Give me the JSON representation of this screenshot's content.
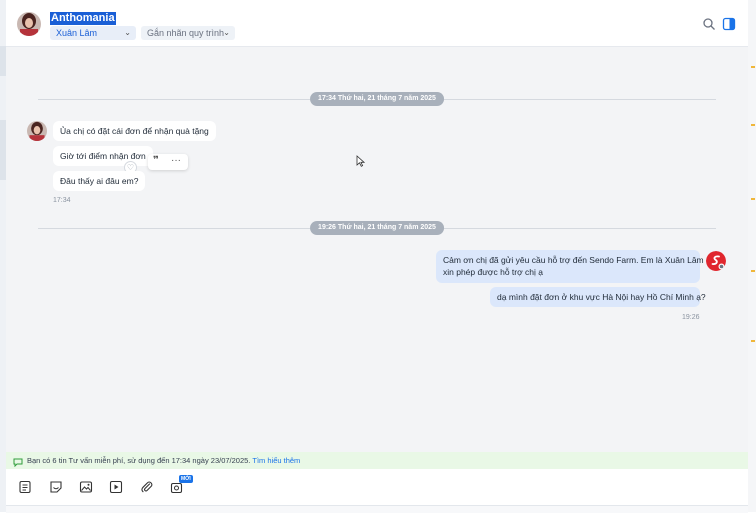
{
  "header": {
    "contact_name": "Anthomania",
    "agent_selector": "Xuân Lâm",
    "process_selector": "Gắn nhãn quy trình",
    "icons": [
      "search-icon",
      "side-panel-icon"
    ]
  },
  "chat": {
    "separators": [
      "17:34 Thứ hai, 21 tháng 7 năm 2025",
      "19:26 Thứ hai, 21 tháng 7 năm 2025"
    ],
    "incoming": [
      "Ủa chị có đặt cái đơn để nhận quà tặng",
      "Giờ tới điểm nhận đơn",
      "Đâu thấy ai đâu em?"
    ],
    "incoming_time": "17:34",
    "outgoing": [
      "Cảm ơn chị đã gửi yêu cầu hỗ trợ đến Sendo Farm. Em là Xuân Lâm",
      "xin phép được hỗ trợ chị ạ",
      "dạ mình đặt đơn ở khu vực Hà Nội hay Hồ Chí Minh ạ?"
    ],
    "outgoing_time": "19:26",
    "hover_actions": [
      "quote-icon",
      "more-icon"
    ]
  },
  "notice": {
    "text": "Bạn có 6 tin Tư vấn miễn phí, sử dụng đến 17:34 ngày 23/07/2025.",
    "link": "Tìm hiểu thêm"
  },
  "toolbar": {
    "tools": [
      "template-icon",
      "sticker-icon",
      "image-icon",
      "video-icon",
      "attachment-icon",
      "product-icon"
    ],
    "new_badge": "MỚI"
  },
  "colors": {
    "accent": "#1a73e8",
    "incoming_bubble": "#ffffff",
    "outgoing_bubble": "#dbe7fb",
    "chat_bg": "#f3f4f6",
    "notice_bg": "#e9f8e6",
    "brand_red": "#e0262d"
  }
}
